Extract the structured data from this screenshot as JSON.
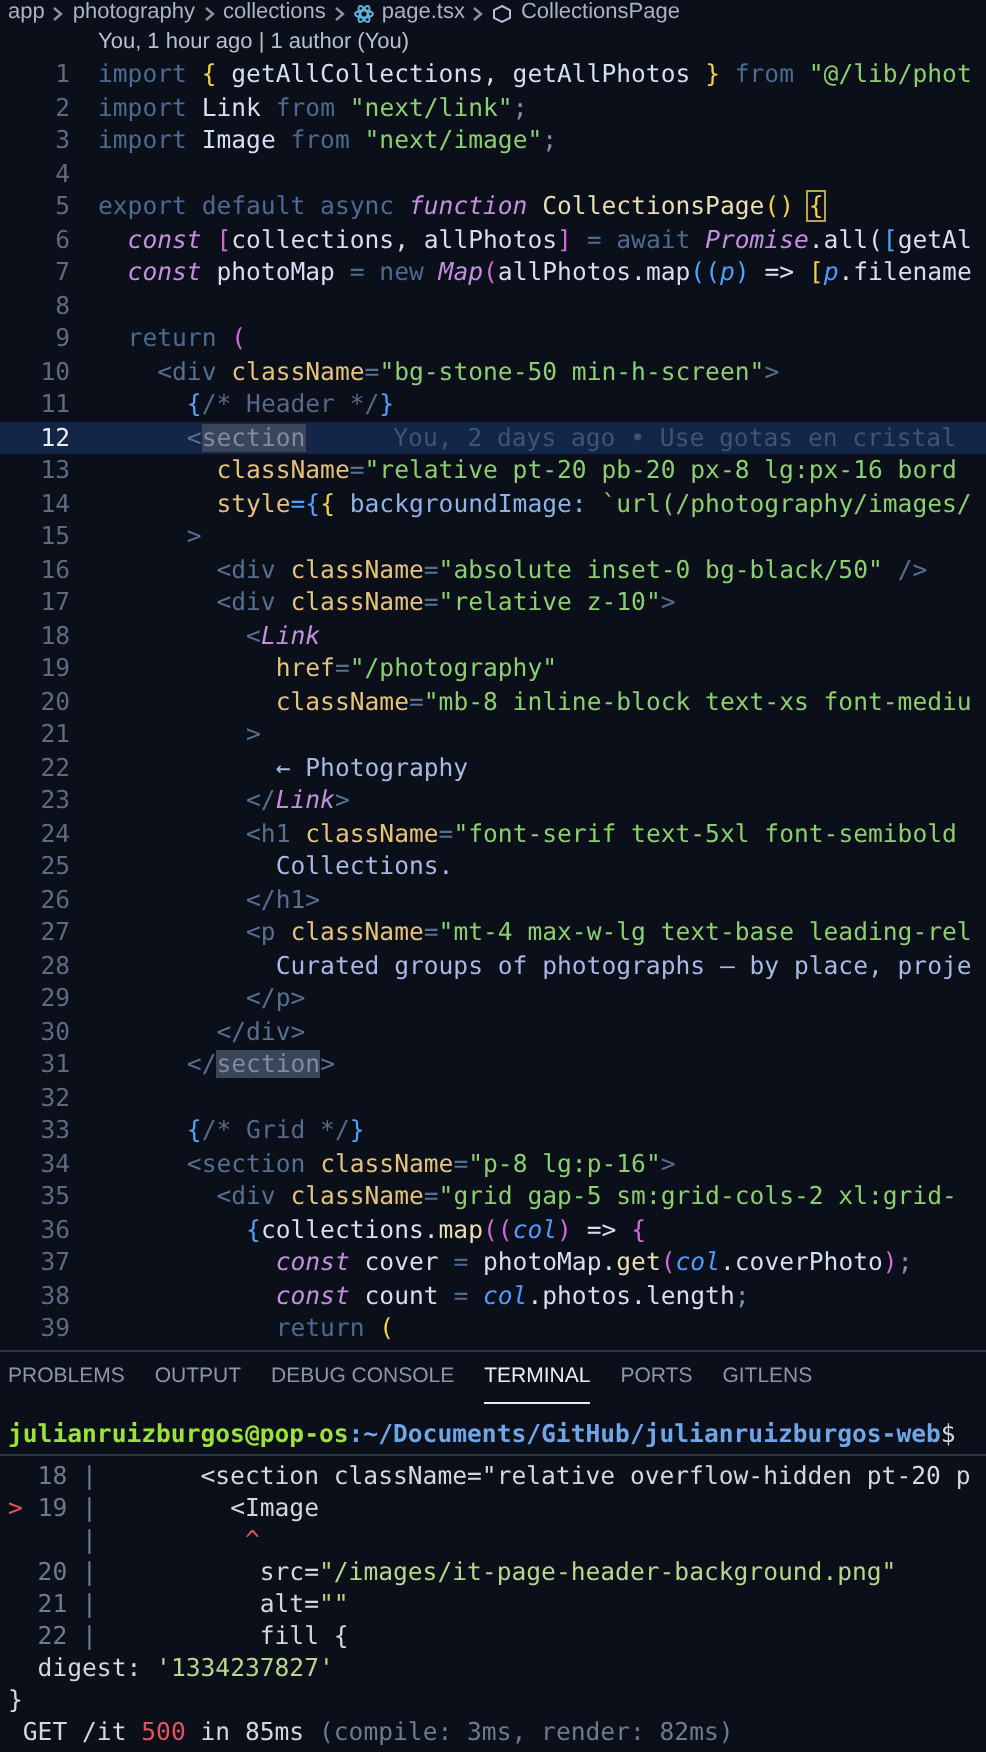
{
  "breadcrumb": [
    {
      "text": "app",
      "kind": "folder"
    },
    {
      "text": "photography",
      "kind": "folder"
    },
    {
      "text": "collections",
      "kind": "folder"
    },
    {
      "text": "page.tsx",
      "kind": "file"
    },
    {
      "text": "CollectionsPage",
      "kind": "symbol"
    }
  ],
  "blame_header": "You, 1 hour ago | 1 author (You)",
  "code_lines": [
    {
      "number": "1",
      "selected": false,
      "tokens": [
        {
          "text": "import ",
          "kind": "kw"
        },
        {
          "text": "{ ",
          "kind": "by"
        },
        {
          "text": "getAllCollections, getAllPhotos ",
          "kind": "id"
        },
        {
          "text": "} ",
          "kind": "by"
        },
        {
          "text": "from ",
          "kind": "kw"
        },
        {
          "text": "\"@/lib/phot",
          "kind": "str"
        }
      ]
    },
    {
      "number": "2",
      "selected": false,
      "tokens": [
        {
          "text": "import ",
          "kind": "kw"
        },
        {
          "text": "Link ",
          "kind": "id"
        },
        {
          "text": "from ",
          "kind": "kw"
        },
        {
          "text": "\"next/link\"",
          "kind": "str"
        },
        {
          "text": ";",
          "kind": "punct"
        }
      ]
    },
    {
      "number": "3",
      "selected": false,
      "tokens": [
        {
          "text": "import ",
          "kind": "kw"
        },
        {
          "text": "Image ",
          "kind": "id"
        },
        {
          "text": "from ",
          "kind": "kw"
        },
        {
          "text": "\"next/image\"",
          "kind": "str"
        },
        {
          "text": ";",
          "kind": "punct"
        }
      ]
    },
    {
      "number": "4",
      "selected": false
    },
    {
      "number": "5",
      "selected": false,
      "tokens": [
        {
          "text": "export default async ",
          "kind": "kw"
        },
        {
          "text": "function ",
          "kind": "ital"
        },
        {
          "text": "CollectionsPage",
          "kind": "fn"
        },
        {
          "text": "() ",
          "kind": "by"
        },
        {
          "text": "{",
          "kind": "bracket"
        }
      ]
    },
    {
      "number": "6",
      "selected": false,
      "tokens": [
        {
          "text": "  const ",
          "kind": "ital"
        },
        {
          "text": "[",
          "kind": "bp"
        },
        {
          "text": "collections, allPhotos",
          "kind": "id"
        },
        {
          "text": "] ",
          "kind": "bp"
        },
        {
          "text": "= await ",
          "kind": "kw"
        },
        {
          "text": "Promise",
          "kind": "ital"
        },
        {
          "text": ".all(",
          "kind": "id"
        },
        {
          "text": "[",
          "kind": "bb"
        },
        {
          "text": "getAl",
          "kind": "id"
        }
      ]
    },
    {
      "number": "7",
      "selected": false,
      "tokens": [
        {
          "text": "  const ",
          "kind": "ital"
        },
        {
          "text": "photoMap ",
          "kind": "id"
        },
        {
          "text": "= new ",
          "kind": "kw"
        },
        {
          "text": "Map",
          "kind": "ital"
        },
        {
          "text": "(",
          "kind": "bp"
        },
        {
          "text": "allPhotos.map",
          "kind": "id"
        },
        {
          "text": "((",
          "kind": "bb"
        },
        {
          "text": "p",
          "kind": "param"
        },
        {
          "text": ") ",
          "kind": "bb"
        },
        {
          "text": "=> ",
          "kind": "id"
        },
        {
          "text": "[",
          "kind": "by"
        },
        {
          "text": "p",
          "kind": "param"
        },
        {
          "text": ".filename",
          "kind": "id"
        }
      ]
    },
    {
      "number": "8",
      "selected": false
    },
    {
      "number": "9",
      "selected": false,
      "tokens": [
        {
          "text": "  return ",
          "kind": "kw"
        },
        {
          "text": "(",
          "kind": "bp"
        }
      ]
    },
    {
      "number": "10",
      "selected": false,
      "tokens": [
        {
          "text": "    <div ",
          "kind": "tag"
        },
        {
          "text": "className",
          "kind": "attr"
        },
        {
          "text": "=",
          "kind": "tag"
        },
        {
          "text": "\"bg-stone-50 min-h-screen\"",
          "kind": "str"
        },
        {
          "text": ">",
          "kind": "tag"
        }
      ]
    },
    {
      "number": "11",
      "selected": false,
      "tokens": [
        {
          "text": "      {",
          "kind": "bb"
        },
        {
          "text": "/* Header */",
          "kind": "comment"
        },
        {
          "text": "}",
          "kind": "bb"
        }
      ]
    },
    {
      "number": "12",
      "selected": true,
      "tokens": [
        {
          "text": "      <",
          "kind": "tag"
        },
        {
          "text": "section",
          "kind": "match"
        }
      ],
      "blame": "You, 2 days ago • Use gotas en cristal"
    },
    {
      "number": "13",
      "selected": false,
      "tokens": [
        {
          "text": "        className",
          "kind": "attr"
        },
        {
          "text": "=",
          "kind": "tag"
        },
        {
          "text": "\"relative pt-20 pb-20 px-8 lg:px-16 bord",
          "kind": "str"
        }
      ]
    },
    {
      "number": "14",
      "selected": false,
      "tokens": [
        {
          "text": "        style",
          "kind": "attr"
        },
        {
          "text": "={",
          "kind": "bb"
        },
        {
          "text": "{ ",
          "kind": "by"
        },
        {
          "text": "backgroundImage: ",
          "kind": "prop"
        },
        {
          "text": "`url(/photography/images/",
          "kind": "str"
        }
      ]
    },
    {
      "number": "15",
      "selected": false,
      "tokens": [
        {
          "text": "      >",
          "kind": "tag"
        }
      ]
    },
    {
      "number": "16",
      "selected": false,
      "tokens": [
        {
          "text": "        <div ",
          "kind": "tag"
        },
        {
          "text": "className",
          "kind": "attr"
        },
        {
          "text": "=",
          "kind": "tag"
        },
        {
          "text": "\"absolute inset-0 bg-black/50\" ",
          "kind": "str"
        },
        {
          "text": "/>",
          "kind": "tag"
        }
      ]
    },
    {
      "number": "17",
      "selected": false,
      "tokens": [
        {
          "text": "        <div ",
          "kind": "tag"
        },
        {
          "text": "className",
          "kind": "attr"
        },
        {
          "text": "=",
          "kind": "tag"
        },
        {
          "text": "\"relative z-10\"",
          "kind": "str"
        },
        {
          "text": ">",
          "kind": "tag"
        }
      ]
    },
    {
      "number": "18",
      "selected": false,
      "tokens": [
        {
          "text": "          <",
          "kind": "tag"
        },
        {
          "text": "Link",
          "kind": "ital"
        }
      ]
    },
    {
      "number": "19",
      "selected": false,
      "tokens": [
        {
          "text": "            href",
          "kind": "attr"
        },
        {
          "text": "=",
          "kind": "tag"
        },
        {
          "text": "\"/photography\"",
          "kind": "str"
        }
      ]
    },
    {
      "number": "20",
      "selected": false,
      "tokens": [
        {
          "text": "            className",
          "kind": "attr"
        },
        {
          "text": "=",
          "kind": "tag"
        },
        {
          "text": "\"mb-8 inline-block text-xs font-mediu",
          "kind": "str"
        }
      ]
    },
    {
      "number": "21",
      "selected": false,
      "tokens": [
        {
          "text": "          >",
          "kind": "tag"
        }
      ]
    },
    {
      "number": "22",
      "selected": false,
      "tokens": [
        {
          "text": "            ← Photography",
          "kind": "text"
        }
      ]
    },
    {
      "number": "23",
      "selected": false,
      "tokens": [
        {
          "text": "          </",
          "kind": "tag"
        },
        {
          "text": "Link",
          "kind": "ital"
        },
        {
          "text": ">",
          "kind": "tag"
        }
      ]
    },
    {
      "number": "24",
      "selected": false,
      "tokens": [
        {
          "text": "          <h1 ",
          "kind": "tag"
        },
        {
          "text": "className",
          "kind": "attr"
        },
        {
          "text": "=",
          "kind": "tag"
        },
        {
          "text": "\"font-serif text-5xl font-semibold",
          "kind": "str"
        }
      ]
    },
    {
      "number": "25",
      "selected": false,
      "tokens": [
        {
          "text": "            Collections.",
          "kind": "text"
        }
      ]
    },
    {
      "number": "26",
      "selected": false,
      "tokens": [
        {
          "text": "          </h1>",
          "kind": "tag"
        }
      ]
    },
    {
      "number": "27",
      "selected": false,
      "tokens": [
        {
          "text": "          <p ",
          "kind": "tag"
        },
        {
          "text": "className",
          "kind": "attr"
        },
        {
          "text": "=",
          "kind": "tag"
        },
        {
          "text": "\"mt-4 max-w-lg text-base leading-rel",
          "kind": "str"
        }
      ]
    },
    {
      "number": "28",
      "selected": false,
      "tokens": [
        {
          "text": "            Curated groups of photographs — by place, proje",
          "kind": "text"
        }
      ]
    },
    {
      "number": "29",
      "selected": false,
      "tokens": [
        {
          "text": "          </p>",
          "kind": "tag"
        }
      ]
    },
    {
      "number": "30",
      "selected": false,
      "tokens": [
        {
          "text": "        </div>",
          "kind": "tag"
        }
      ]
    },
    {
      "number": "31",
      "selected": false,
      "tokens": [
        {
          "text": "      </",
          "kind": "tag"
        },
        {
          "text": "section",
          "kind": "match"
        },
        {
          "text": ">",
          "kind": "tag"
        }
      ]
    },
    {
      "number": "32",
      "selected": false
    },
    {
      "number": "33",
      "selected": false,
      "tokens": [
        {
          "text": "      {",
          "kind": "bb"
        },
        {
          "text": "/* Grid */",
          "kind": "comment"
        },
        {
          "text": "}",
          "kind": "bb"
        }
      ]
    },
    {
      "number": "34",
      "selected": false,
      "tokens": [
        {
          "text": "      <section ",
          "kind": "tag"
        },
        {
          "text": "className",
          "kind": "attr"
        },
        {
          "text": "=",
          "kind": "tag"
        },
        {
          "text": "\"p-8 lg:p-16\"",
          "kind": "str"
        },
        {
          "text": ">",
          "kind": "tag"
        }
      ]
    },
    {
      "number": "35",
      "selected": false,
      "tokens": [
        {
          "text": "        <div ",
          "kind": "tag"
        },
        {
          "text": "className",
          "kind": "attr"
        },
        {
          "text": "=",
          "kind": "tag"
        },
        {
          "text": "\"grid gap-5 sm:grid-cols-2 xl:grid-",
          "kind": "str"
        }
      ]
    },
    {
      "number": "36",
      "selected": false,
      "tokens": [
        {
          "text": "          {",
          "kind": "bb"
        },
        {
          "text": "collections.",
          "kind": "id"
        },
        {
          "text": "map",
          "kind": "fn"
        },
        {
          "text": "((",
          "kind": "bp"
        },
        {
          "text": "col",
          "kind": "param"
        },
        {
          "text": ") ",
          "kind": "bp"
        },
        {
          "text": "=> ",
          "kind": "id"
        },
        {
          "text": "{",
          "kind": "bp"
        }
      ]
    },
    {
      "number": "37",
      "selected": false,
      "tokens": [
        {
          "text": "            const ",
          "kind": "ital"
        },
        {
          "text": "cover ",
          "kind": "id"
        },
        {
          "text": "= ",
          "kind": "kw"
        },
        {
          "text": "photoMap.",
          "kind": "id"
        },
        {
          "text": "get",
          "kind": "fn"
        },
        {
          "text": "(",
          "kind": "bp"
        },
        {
          "text": "col",
          "kind": "param"
        },
        {
          "text": ".coverPhoto",
          "kind": "id"
        },
        {
          "text": ")",
          "kind": "bp"
        },
        {
          "text": ";",
          "kind": "punct"
        }
      ]
    },
    {
      "number": "38",
      "selected": false,
      "tokens": [
        {
          "text": "            const ",
          "kind": "ital"
        },
        {
          "text": "count ",
          "kind": "id"
        },
        {
          "text": "= ",
          "kind": "kw"
        },
        {
          "text": "col",
          "kind": "param"
        },
        {
          "text": ".photos.length",
          "kind": "id"
        },
        {
          "text": ";",
          "kind": "punct"
        }
      ]
    },
    {
      "number": "39",
      "selected": false,
      "tokens": [
        {
          "text": "            return ",
          "kind": "kw"
        },
        {
          "text": "(",
          "kind": "by"
        }
      ]
    }
  ],
  "panel_tabs": [
    {
      "label": "PROBLEMS",
      "selected": false
    },
    {
      "label": "OUTPUT",
      "selected": false
    },
    {
      "label": "DEBUG CONSOLE",
      "selected": false
    },
    {
      "label": "TERMINAL",
      "selected": true
    },
    {
      "label": "PORTS",
      "selected": false
    },
    {
      "label": "GITLENS",
      "selected": false
    }
  ],
  "terminal_lines": [
    {
      "tokens": [
        {
          "text": "julianruizburgos@pop-os",
          "kind": "user"
        },
        {
          "text": ":~/Documents/GitHub/julianruizburgos-web",
          "kind": "path"
        },
        {
          "text": "$",
          "kind": "plain"
        }
      ]
    },
    {
      "tokens": [
        {
          "text": "  18 | ",
          "kind": "gutter"
        },
        {
          "text": "      <section className=\"relative overflow-hidden pt-20 p",
          "kind": "plain"
        }
      ]
    },
    {
      "tokens": [
        {
          "text": "> ",
          "kind": "marker"
        },
        {
          "text": "19 | ",
          "kind": "gutter"
        },
        {
          "text": "        <Image",
          "kind": "plain"
        }
      ]
    },
    {
      "tokens": [
        {
          "text": "     | ",
          "kind": "gutter"
        },
        {
          "text": "         ^",
          "kind": "marker"
        }
      ]
    },
    {
      "tokens": [
        {
          "text": "  20 | ",
          "kind": "gutter"
        },
        {
          "text": "          src=",
          "kind": "plain"
        },
        {
          "text": "\"/images/it-page-header-background.png\"",
          "kind": "tstr"
        }
      ]
    },
    {
      "tokens": [
        {
          "text": "  21 | ",
          "kind": "gutter"
        },
        {
          "text": "          alt=",
          "kind": "plain"
        },
        {
          "text": "\"\"",
          "kind": "tstr"
        }
      ]
    },
    {
      "tokens": [
        {
          "text": "  22 | ",
          "kind": "gutter"
        },
        {
          "text": "          fill {",
          "kind": "plain"
        }
      ]
    },
    {
      "tokens": [
        {
          "text": "  digest: ",
          "kind": "plain"
        },
        {
          "text": "'1334237827'",
          "kind": "tstr"
        }
      ]
    },
    {
      "tokens": [
        {
          "text": "}",
          "kind": "plain"
        }
      ]
    },
    {
      "tokens": [
        {
          "text": " GET /it ",
          "kind": "plain"
        },
        {
          "text": "500",
          "kind": "marker"
        },
        {
          "text": " in 85ms ",
          "kind": "plain"
        },
        {
          "text": "(compile: 3ms, render: 82ms)",
          "kind": "gutter"
        }
      ]
    }
  ]
}
